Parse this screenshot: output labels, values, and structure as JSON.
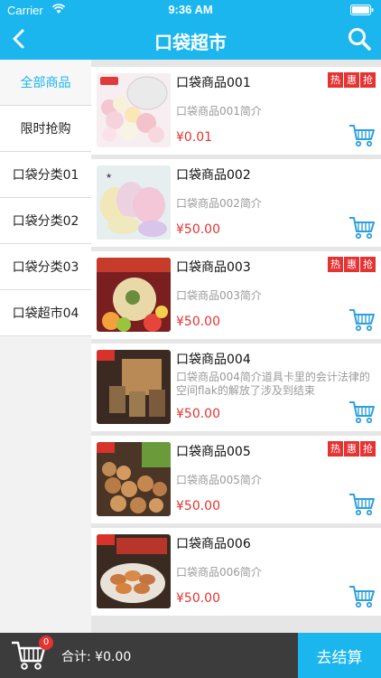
{
  "status_bar": {
    "carrier": "Carrier",
    "time": "9:36 AM"
  },
  "nav": {
    "title": "口袋超市",
    "back_icon": "chevron-left-icon",
    "search_icon": "search-icon"
  },
  "sidebar": {
    "items": [
      {
        "label": "全部商品",
        "active": true
      },
      {
        "label": "限时抢购"
      },
      {
        "label": "口袋分类01"
      },
      {
        "label": "口袋分类02"
      },
      {
        "label": "口袋分类03"
      },
      {
        "label": "口袋超市04"
      }
    ]
  },
  "products": [
    {
      "name": "口袋商品001",
      "desc": "口袋商品001简介",
      "price": "¥0.01",
      "tags": [
        "热",
        "惠",
        "抢"
      ]
    },
    {
      "name": "口袋商品002",
      "desc": "口袋商品002简介",
      "price": "¥50.00",
      "tags": []
    },
    {
      "name": "口袋商品003",
      "desc": "口袋商品003简介",
      "price": "¥50.00",
      "tags": [
        "热",
        "惠",
        "抢"
      ]
    },
    {
      "name": "口袋商品004",
      "desc": "口袋商品004简介道具卡里的会计法律的空间flak的解放了涉及到结束",
      "price": "¥50.00",
      "tags": []
    },
    {
      "name": "口袋商品005",
      "desc": "口袋商品005简介",
      "price": "¥50.00",
      "tags": [
        "热",
        "惠",
        "抢"
      ]
    },
    {
      "name": "口袋商品006",
      "desc": "口袋商品006简介",
      "price": "¥50.00",
      "tags": []
    }
  ],
  "bottom": {
    "cart_count": "0",
    "total": "合计: ¥0.00",
    "checkout": "去结算"
  },
  "colors": {
    "accent": "#1bb6ee",
    "price": "#e53232",
    "bottom_bg": "#3c3c3c"
  }
}
